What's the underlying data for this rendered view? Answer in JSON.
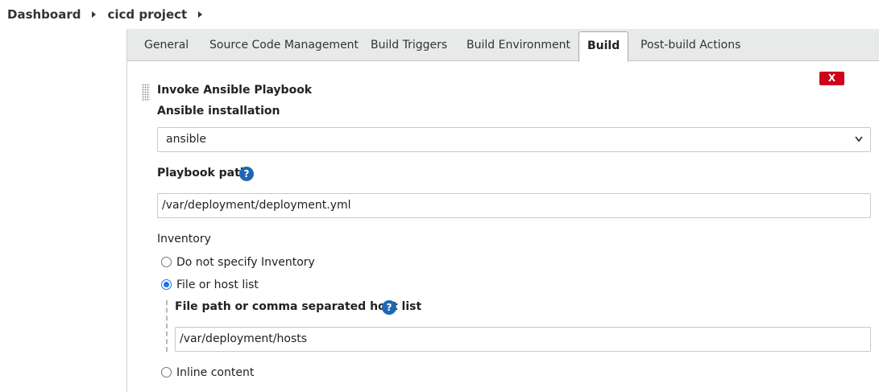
{
  "breadcrumb": {
    "items": [
      "Dashboard",
      "cicd project"
    ]
  },
  "tabs": [
    {
      "label": "General",
      "active": false
    },
    {
      "label": "Source Code Management",
      "active": false
    },
    {
      "label": "Build Triggers",
      "active": false
    },
    {
      "label": "Build Environment",
      "active": false
    },
    {
      "label": "Build",
      "active": true
    },
    {
      "label": "Post-build Actions",
      "active": false
    }
  ],
  "build_step": {
    "title": "Invoke Ansible Playbook",
    "delete_label": "X",
    "ansible_installation": {
      "label": "Ansible installation",
      "selected": "ansible"
    },
    "playbook_path": {
      "label": "Playbook path",
      "value": "/var/deployment/deployment.yml",
      "help": "?"
    },
    "inventory": {
      "label": "Inventory",
      "options": [
        {
          "label": "Do not specify Inventory",
          "checked": false
        },
        {
          "label": "File or host list",
          "checked": true
        },
        {
          "label": "Inline content",
          "checked": false
        }
      ],
      "file_path": {
        "label": "File path or comma separated host list",
        "value": "/var/deployment/hosts",
        "help": "?"
      }
    }
  },
  "colors": {
    "delete_button": "#d0021b",
    "help_icon": "#1f67b4",
    "radio_checked": "#1a73e8",
    "tabbar_bg": "#e8eaea"
  }
}
